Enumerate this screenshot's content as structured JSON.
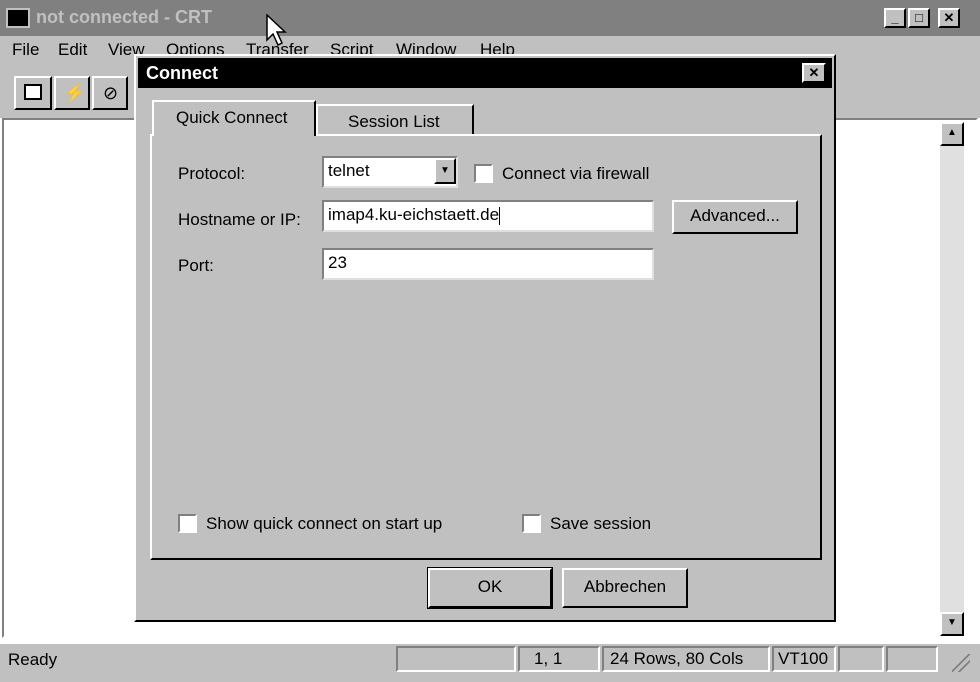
{
  "window": {
    "title": "not connected - CRT"
  },
  "menu": [
    "File",
    "Edit",
    "View",
    "Options",
    "Transfer",
    "Script",
    "Window",
    "Help"
  ],
  "toolbar": {
    "icons": [
      "connect-icon",
      "quick-connect-icon",
      "disconnect-icon"
    ]
  },
  "status": {
    "text": "Ready",
    "position": "1,  1",
    "size": "24 Rows,  80 Cols",
    "emulation": "VT100"
  },
  "dialog": {
    "title": "Connect",
    "tabs": [
      "Quick Connect",
      "Session List"
    ],
    "protocol_label": "Protocol:",
    "protocol_value": "telnet",
    "firewall_label": "Connect via firewall",
    "hostname_label": "Hostname or IP:",
    "hostname_value": "imap4.ku-eichstaett.de",
    "advanced_button": "Advanced...",
    "port_label": "Port:",
    "port_value": "23",
    "show_quick_label": "Show quick connect on start up",
    "save_session_label": "Save session",
    "ok_button": "OK",
    "cancel_button": "Abbrechen"
  }
}
